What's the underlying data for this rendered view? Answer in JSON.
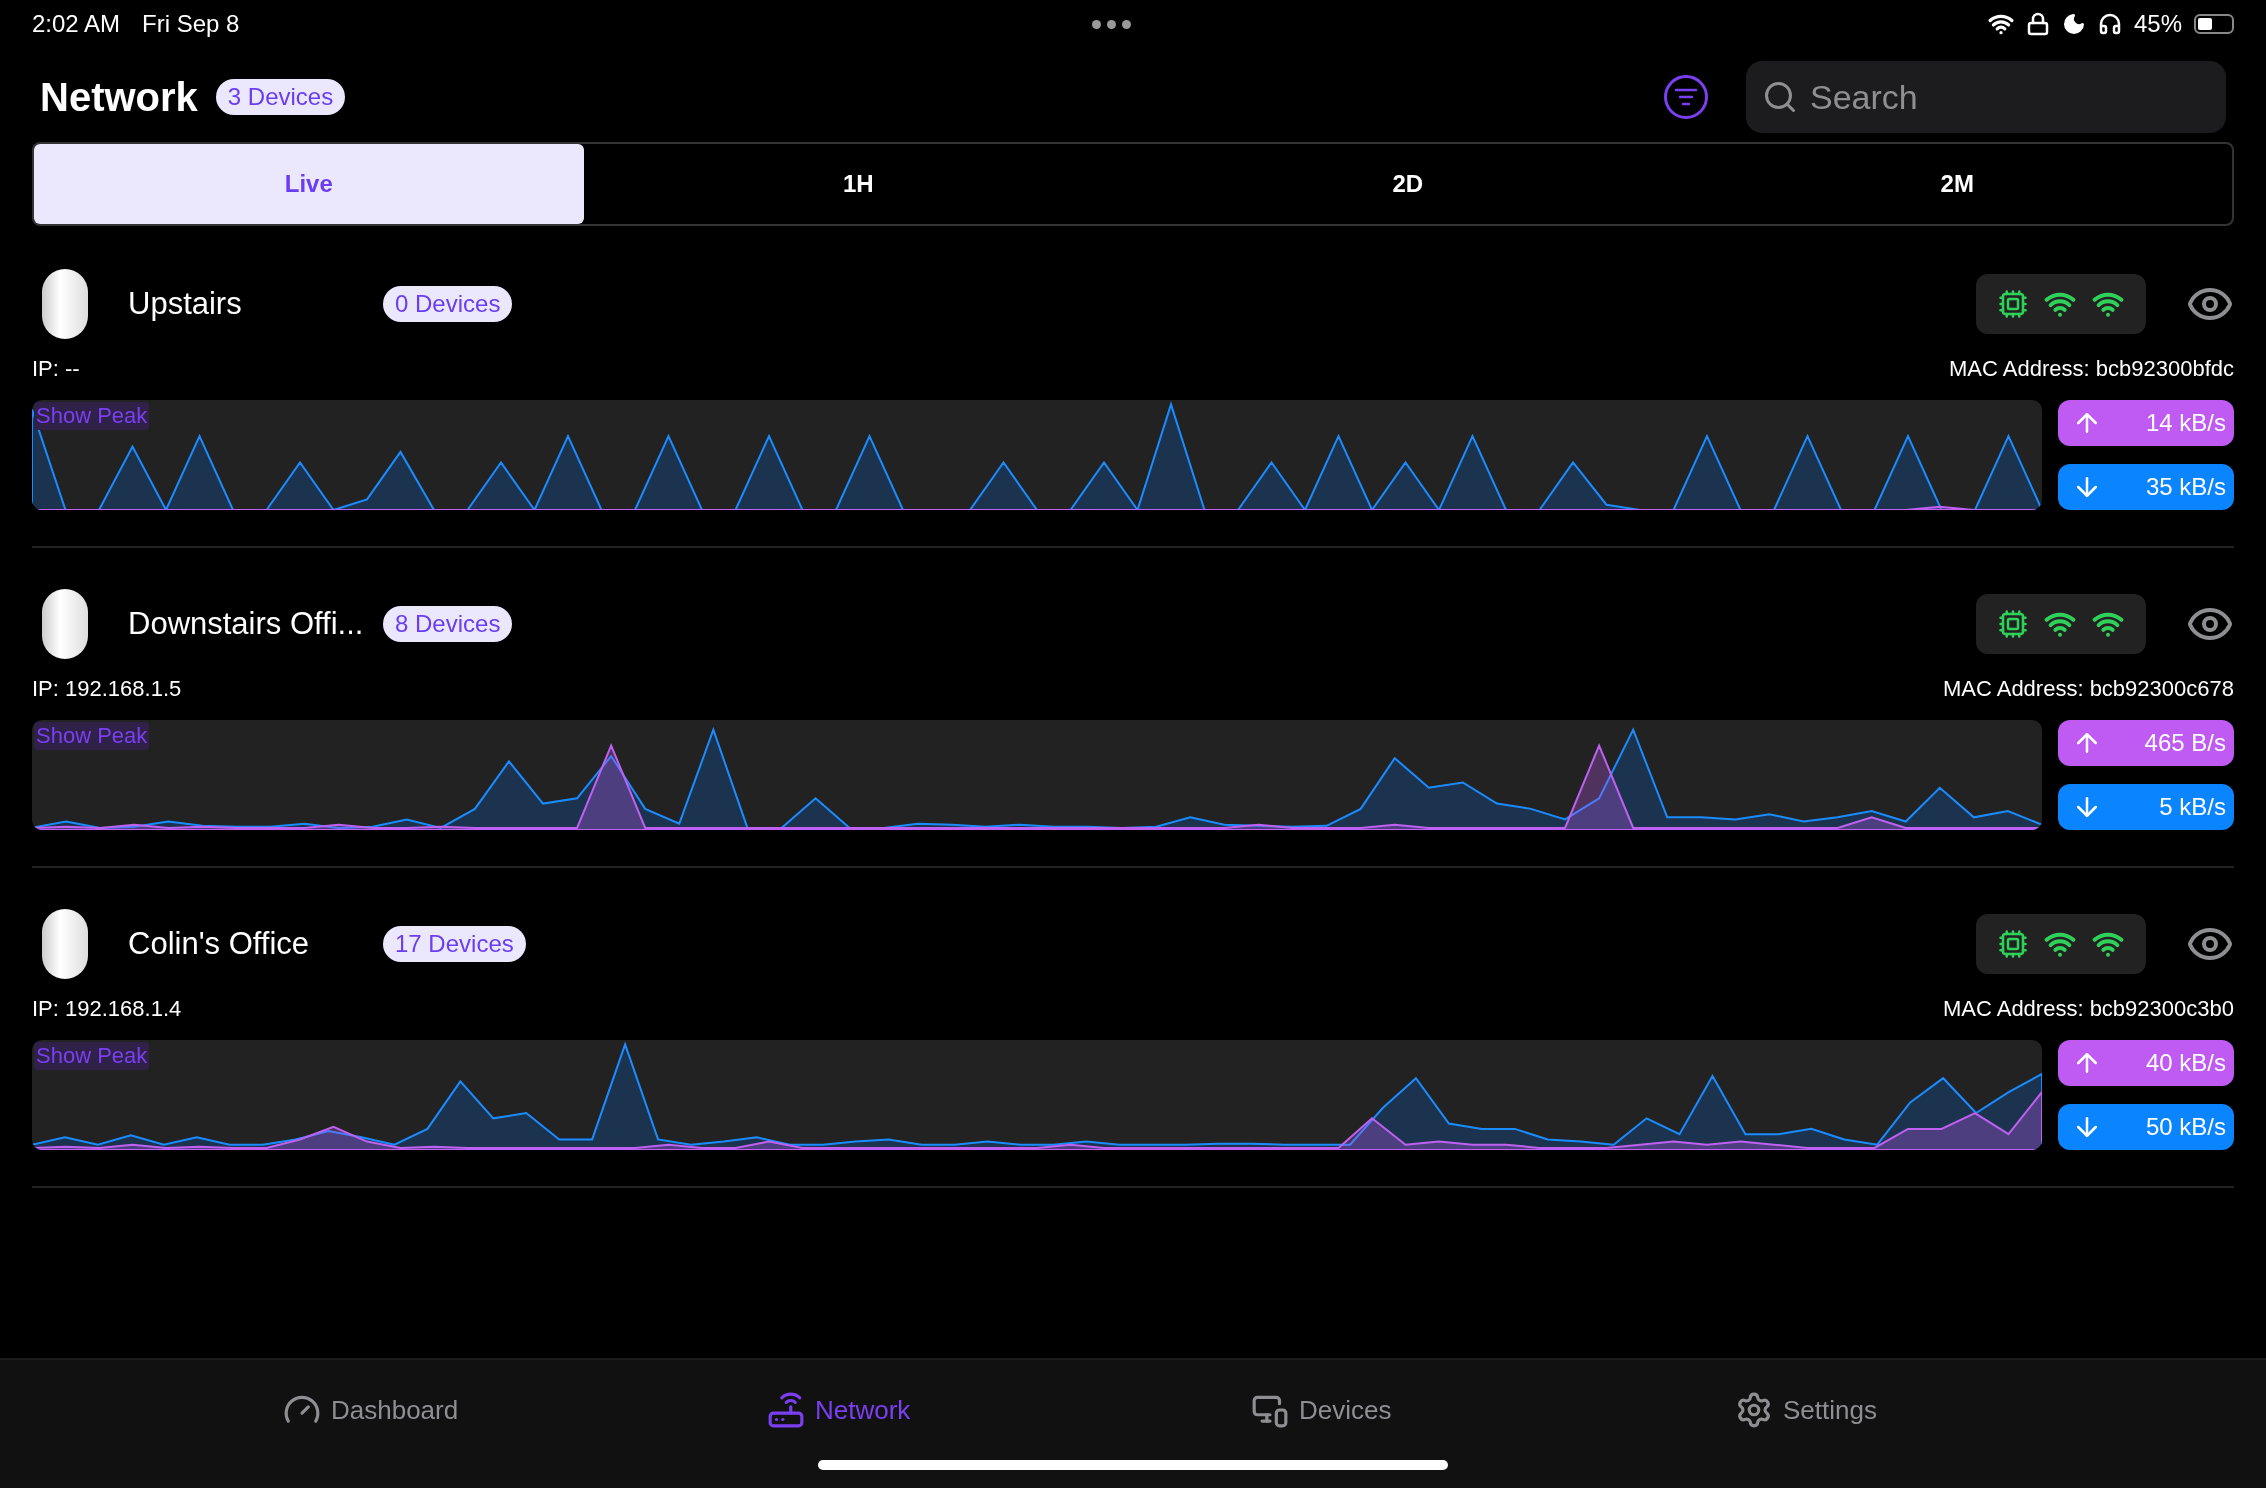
{
  "status_bar": {
    "time": "2:02 AM",
    "date": "Fri Sep 8",
    "battery": "45%"
  },
  "header": {
    "title": "Network",
    "count": "3 Devices",
    "search": {
      "placeholder": "Search"
    }
  },
  "tabs": [
    {
      "label": "Live",
      "selected": true
    },
    {
      "label": "1H",
      "selected": false
    },
    {
      "label": "2D",
      "selected": false
    },
    {
      "label": "2M",
      "selected": false
    }
  ],
  "routers": [
    {
      "name": "Upstairs",
      "devices": "0 Devices",
      "ip": "IP: --",
      "mac": "MAC Address: bcb92300bfdc",
      "peak_label": "Show Peak",
      "upload": "14 kB/s",
      "download": "35 kB/s"
    },
    {
      "name": "Downstairs Offi...",
      "devices": "8 Devices",
      "ip": "IP: 192.168.1.5",
      "mac": "MAC Address: bcb92300c678",
      "peak_label": "Show Peak",
      "upload": "465 B/s",
      "download": "5 kB/s"
    },
    {
      "name": "Colin's Office",
      "devices": "17 Devices",
      "ip": "IP: 192.168.1.4",
      "mac": "MAC Address: bcb92300c3b0",
      "peak_label": "Show Peak",
      "upload": "40 kB/s",
      "download": "50 kB/s"
    }
  ],
  "nav": [
    {
      "label": "Dashboard",
      "kind": "gauge",
      "selected": false
    },
    {
      "label": "Network",
      "kind": "router",
      "selected": true
    },
    {
      "label": "Devices",
      "kind": "devices",
      "selected": false
    },
    {
      "label": "Settings",
      "kind": "gear",
      "selected": false
    }
  ]
}
